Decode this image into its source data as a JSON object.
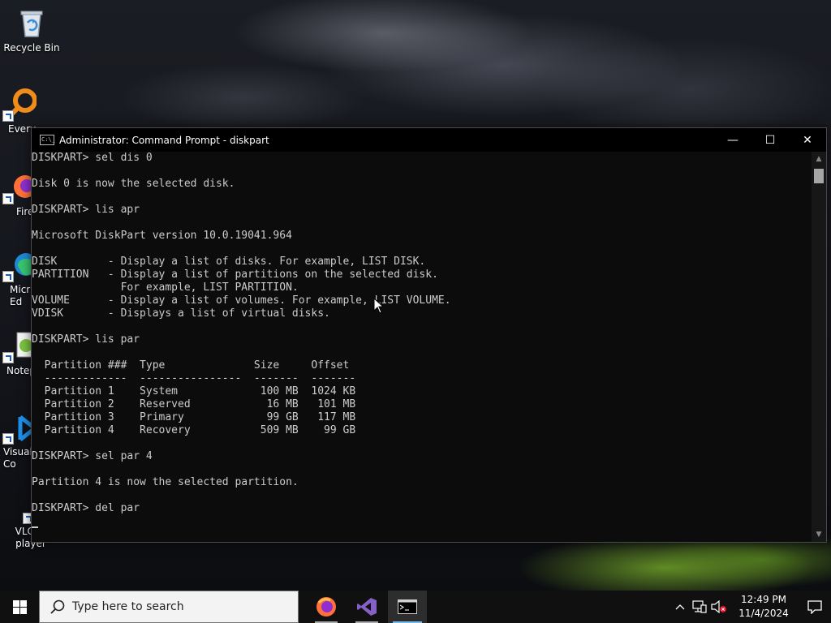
{
  "desktop": {
    "icons": [
      {
        "label": "Recycle Bin"
      },
      {
        "label": "Every"
      },
      {
        "label": "Fire"
      },
      {
        "label": "Micr\nEd"
      },
      {
        "label": "Notep"
      },
      {
        "label": "Visual\nCo"
      },
      {
        "label": "VLC m\nplayer"
      }
    ]
  },
  "window": {
    "title": "Administrator: Command Prompt - diskpart",
    "icon_text": "C:\\_",
    "controls": {
      "minimize": "—",
      "maximize": "☐",
      "close": "✕"
    }
  },
  "console": {
    "lines": [
      "DISKPART> sel dis 0",
      "",
      "Disk 0 is now the selected disk.",
      "",
      "DISKPART> lis apr",
      "",
      "Microsoft DiskPart version 10.0.19041.964",
      "",
      "DISK        - Display a list of disks. For example, LIST DISK.",
      "PARTITION   - Display a list of partitions on the selected disk.",
      "              For example, LIST PARTITION.",
      "VOLUME      - Display a list of volumes. For example, LIST VOLUME.",
      "VDISK       - Displays a list of virtual disks.",
      "",
      "DISKPART> lis par",
      "",
      "  Partition ###  Type              Size     Offset",
      "  -------------  ----------------  -------  -------",
      "  Partition 1    System             100 MB  1024 KB",
      "  Partition 2    Reserved            16 MB   101 MB",
      "  Partition 3    Primary             99 GB   117 MB",
      "  Partition 4    Recovery           509 MB    99 GB",
      "",
      "DISKPART> sel par 4",
      "",
      "Partition 4 is now the selected partition.",
      "",
      "DISKPART> del par",
      ""
    ]
  },
  "taskbar": {
    "search_placeholder": "Type here to search",
    "apps": [
      {
        "name": "firefox-icon"
      },
      {
        "name": "visual-studio-icon"
      },
      {
        "name": "command-prompt-icon"
      }
    ],
    "clock": {
      "time": "12:49 PM",
      "date": "11/4/2024"
    }
  },
  "colors": {
    "console_bg": "#0c0c0c",
    "console_fg": "#cccccc",
    "taskbar_bg": "#101010",
    "accent": "#76b9ed"
  }
}
